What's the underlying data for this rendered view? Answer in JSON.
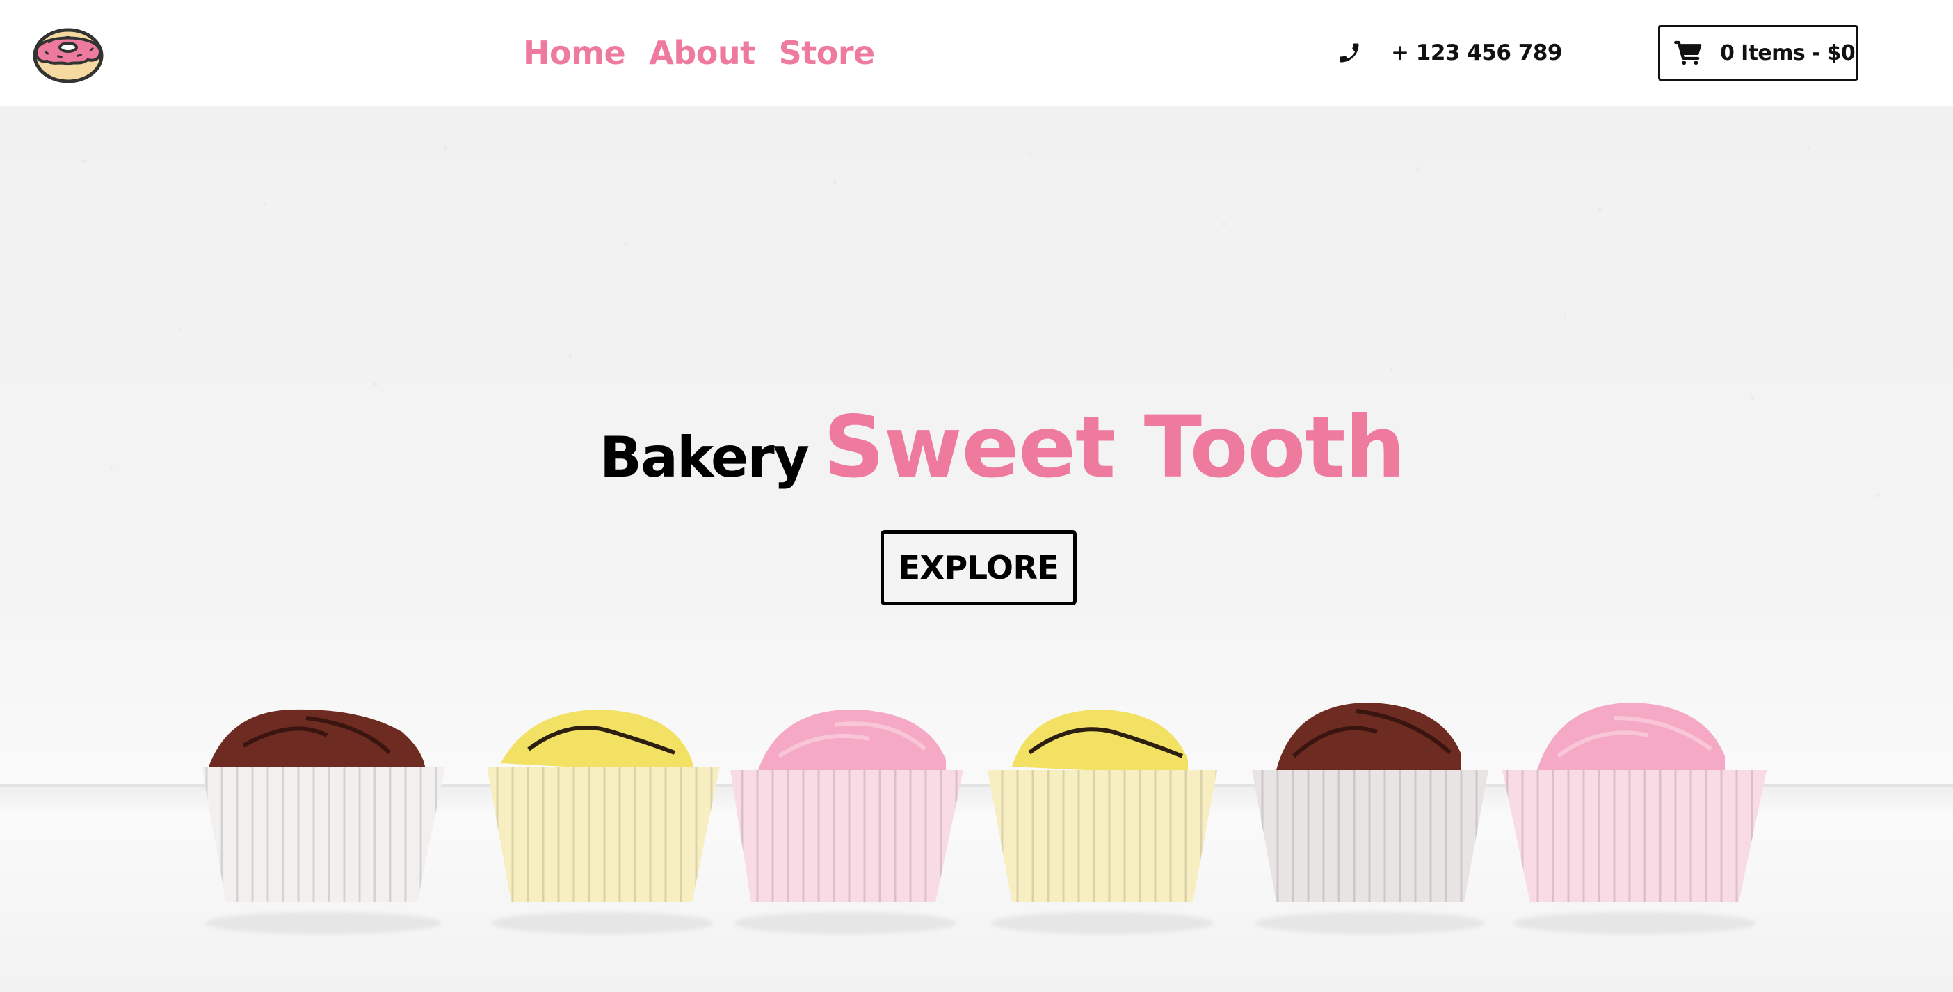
{
  "brand": {
    "logo_icon": "donut-icon"
  },
  "nav": {
    "links": [
      {
        "label": "Home"
      },
      {
        "label": "About"
      },
      {
        "label": "Store"
      }
    ],
    "phone": {
      "icon": "phone-icon",
      "number": "+ 123 456 789"
    },
    "cart": {
      "icon": "shopping-cart-icon",
      "label": "0 Items - $0"
    }
  },
  "hero": {
    "pre_title": "Bakery",
    "title": "Sweet Tooth",
    "button_label": "EXPLORE",
    "image": "row-of-six-glazed-cupcakes"
  },
  "colors": {
    "accent_pink": "#ee7b9d",
    "text_dark": "#111111",
    "background": "#ffffff"
  }
}
